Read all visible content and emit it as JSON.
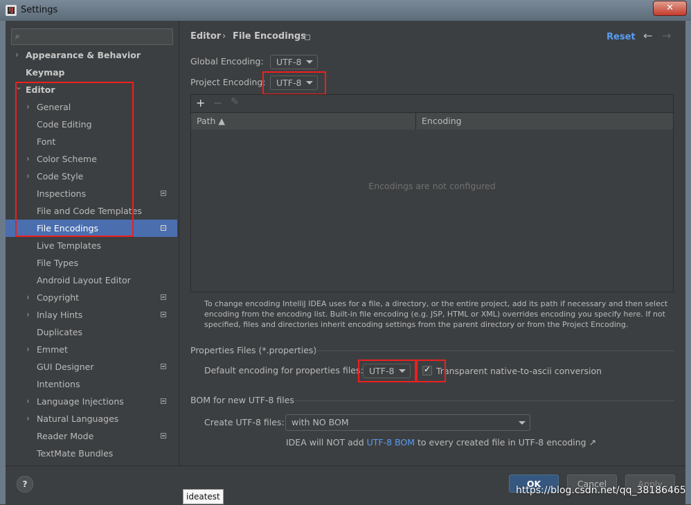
{
  "window": {
    "title": "Settings",
    "close_label": "✕"
  },
  "search": {
    "placeholder": ""
  },
  "sidebar": {
    "items": [
      {
        "label": "Appearance & Behavior",
        "chevron": "›"
      },
      {
        "label": "Keymap"
      },
      {
        "label": "Editor",
        "chevron": "⌄"
      },
      {
        "label": "General",
        "chevron": "›"
      },
      {
        "label": "Code Editing"
      },
      {
        "label": "Font"
      },
      {
        "label": "Color Scheme",
        "chevron": "›"
      },
      {
        "label": "Code Style",
        "chevron": "›"
      },
      {
        "label": "Inspections"
      },
      {
        "label": "File and Code Templates"
      },
      {
        "label": "File Encodings"
      },
      {
        "label": "Live Templates"
      },
      {
        "label": "File Types"
      },
      {
        "label": "Android Layout Editor"
      },
      {
        "label": "Copyright",
        "chevron": "›"
      },
      {
        "label": "Inlay Hints",
        "chevron": "›"
      },
      {
        "label": "Duplicates"
      },
      {
        "label": "Emmet",
        "chevron": "›"
      },
      {
        "label": "GUI Designer"
      },
      {
        "label": "Intentions"
      },
      {
        "label": "Language Injections",
        "chevron": "›"
      },
      {
        "label": "Natural Languages",
        "chevron": "›"
      },
      {
        "label": "Reader Mode"
      },
      {
        "label": "TextMate Bundles"
      }
    ]
  },
  "header": {
    "section": "Editor",
    "separator": "›",
    "page": "File Encodings",
    "reset": "Reset",
    "back": "←",
    "forward": "→"
  },
  "encodings": {
    "global_label": "Global Encoding:",
    "global_value": "UTF-8",
    "project_label": "Project Encoding:",
    "project_value": "UTF-8"
  },
  "table": {
    "add": "+",
    "remove": "−",
    "edit": "✎",
    "columns": [
      "Path ▲",
      "Encoding"
    ],
    "empty_message": "Encodings are not configured"
  },
  "hint": "To change encoding IntelliJ IDEA uses for a file, a directory, or the entire project, add its path if necessary and then select encoding from the encoding list. Built-in file encoding (e.g. JSP, HTML or XML) overrides encoding you specify here. If not specified, files and directories inherit encoding settings from the parent directory or from the Project Encoding.",
  "properties": {
    "title": "Properties Files (*.properties)",
    "default_label": "Default encoding for properties files:",
    "default_value": "UTF-8",
    "checkbox_label": "Transparent native-to-ascii conversion",
    "checkbox_checked": "✓"
  },
  "bom": {
    "title": "BOM for new UTF-8 files",
    "create_label": "Create UTF-8 files:",
    "create_value": "with NO BOM",
    "note_before": "IDEA will NOT add ",
    "note_link": "UTF-8 BOM",
    "note_after": " to every created file in UTF-8 encoding ↗"
  },
  "buttons": {
    "help": "?",
    "ok": "OK",
    "cancel": "Cancel",
    "apply": "Apply"
  },
  "tooltip": "ideatest",
  "watermark": "https://blog.csdn.net/qq_38186465",
  "colors": {
    "accent": "#4b6eaf",
    "link": "#589df6",
    "highlight": "#ee1f1f",
    "background": "#3c3f41"
  }
}
